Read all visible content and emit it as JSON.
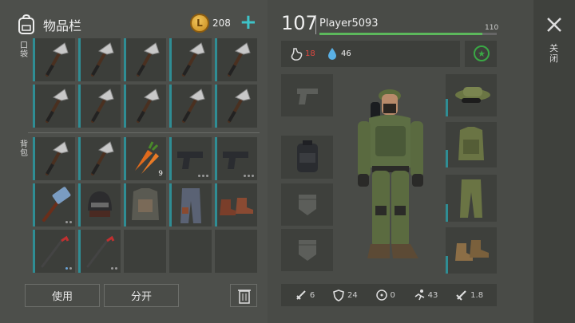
{
  "inventory": {
    "title": "物品栏",
    "coins": "208",
    "coin_symbol": "L",
    "add_symbol": "+",
    "pocket_label": "口袋",
    "backpack_label": "背包",
    "pocket_items": [
      {
        "name": "hatchet"
      },
      {
        "name": "hatchet"
      },
      {
        "name": "hatchet"
      },
      {
        "name": "hatchet"
      },
      {
        "name": "hatchet"
      },
      {
        "name": "hatchet"
      },
      {
        "name": "hatchet"
      },
      {
        "name": "hatchet"
      },
      {
        "name": "hatchet"
      },
      {
        "name": "hatchet"
      }
    ],
    "backpack_items": [
      {
        "name": "hatchet"
      },
      {
        "name": "hatchet"
      },
      {
        "name": "carrot",
        "qty": "9"
      },
      {
        "name": "pistol"
      },
      {
        "name": "pistol"
      },
      {
        "name": "sledgehammer"
      },
      {
        "name": "helmet"
      },
      {
        "name": "armor-vest"
      },
      {
        "name": "pants"
      },
      {
        "name": "boots"
      },
      {
        "name": "crowbar"
      },
      {
        "name": "crowbar"
      },
      {
        "name": "empty"
      },
      {
        "name": "empty"
      },
      {
        "name": "empty"
      }
    ],
    "use_button": "使用",
    "split_button": "分开"
  },
  "character": {
    "level": "107",
    "player_name": "Player5093",
    "xp_max": "110",
    "xp_fraction": 0.92,
    "hunger": "18",
    "thirst": "46",
    "hunger_color": "#e0473f",
    "thirst_color": "#5ab1e6",
    "stats": [
      {
        "icon": "sword-icon",
        "value": "6"
      },
      {
        "icon": "shield-icon",
        "value": "24"
      },
      {
        "icon": "radiation-icon",
        "value": "0"
      },
      {
        "icon": "running-icon",
        "value": "43"
      },
      {
        "icon": "weight-icon",
        "value": "1.8"
      }
    ]
  },
  "close_label": "关闭",
  "accent": "#2f8d94"
}
